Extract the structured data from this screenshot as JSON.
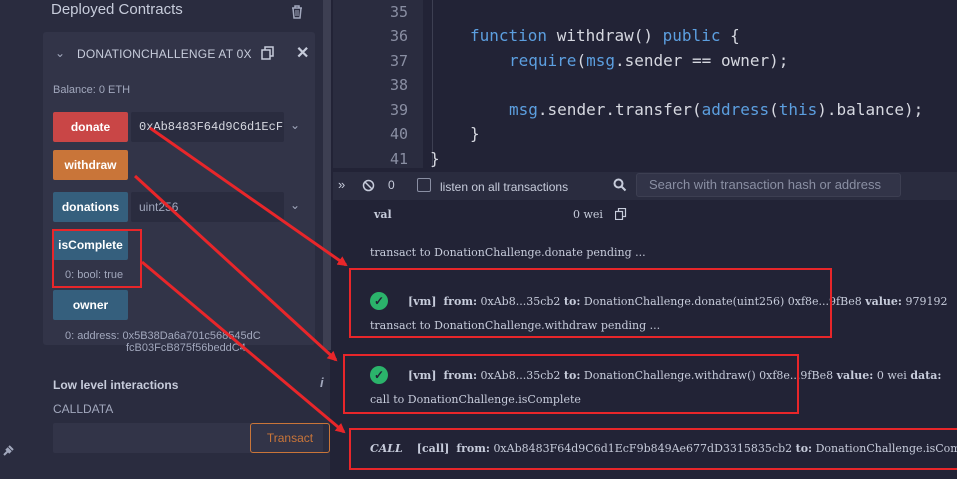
{
  "colors": {
    "donate": "#c94646",
    "withdraw": "#c97539",
    "call": "#355f7d",
    "annotation": "#e8262a",
    "success": "#2bb36b"
  },
  "deployed": {
    "title": "Deployed Contracts",
    "trash_icon": "trash-icon"
  },
  "instance": {
    "name": "DONATIONCHALLENGE AT 0X",
    "balance": "Balance: 0 ETH",
    "functions": [
      {
        "label": "donate",
        "input": "0xAb8483F64d9C6d1EcF"
      },
      {
        "label": "withdraw"
      },
      {
        "label": "donations",
        "input": "uint256"
      },
      {
        "label": "isComplete",
        "output": "0: bool: true"
      },
      {
        "label": "owner",
        "output_line1": "0:  address: 0x5B38Da6a701c568545dC",
        "output_line2": "fcB03FcB875f56beddC4"
      }
    ]
  },
  "low_level": {
    "title": "Low level interactions",
    "info": "i",
    "calldata_label": "CALLDATA",
    "transact": "Transact"
  },
  "editor": {
    "lines": [
      {
        "num": "35",
        "code": ""
      },
      {
        "num": "36",
        "code": "function withdraw() public {"
      },
      {
        "num": "37",
        "code": "require(msg.sender == owner);"
      },
      {
        "num": "38",
        "code": ""
      },
      {
        "num": "39",
        "code": "msg.sender.transfer(address(this).balance);"
      },
      {
        "num": "40",
        "code": "}"
      },
      {
        "num": "41",
        "code": "}"
      }
    ]
  },
  "terminal": {
    "count": "0",
    "listen_label": "listen on all transactions",
    "search_placeholder": "Search with transaction hash or address",
    "val_label": "val",
    "val_value": "0 wei",
    "log1": "transact to DonationChallenge.donate pending ...",
    "tx1": {
      "tag": "[vm]",
      "from_label": "from:",
      "from": "0xAb8...35cb2",
      "to_label": "to:",
      "to": "DonationChallenge.donate(uint256) 0xf8e...9fBe8",
      "value_label": "value:",
      "value": "979192"
    },
    "log2": "transact to DonationChallenge.withdraw pending ...",
    "tx2": {
      "tag": "[vm]",
      "from_label": "from:",
      "from": "0xAb8...35cb2",
      "to_label": "to:",
      "to": "DonationChallenge.withdraw() 0xf8e...9fBe8",
      "value_label": "value:",
      "value": "0 wei",
      "data_label": "data:"
    },
    "log3": "call to DonationChallenge.isComplete",
    "call": {
      "tag": "CALL",
      "sub": "[call]",
      "from_label": "from:",
      "from": "0xAb8483F64d9C6d1EcF9b849Ae677dD3315835cb2",
      "to_label": "to:",
      "to": "DonationChallenge.isComplete("
    }
  }
}
